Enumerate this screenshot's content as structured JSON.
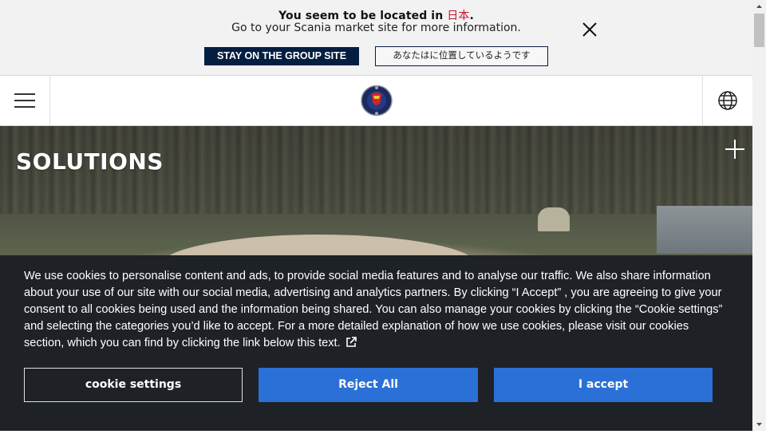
{
  "location_banner": {
    "line1_prefix": "You seem to be located in ",
    "country": "日本",
    "line1_suffix": ".",
    "line2": "Go to your Scania market site for more information.",
    "stay_button": "STAY ON THE GROUP SITE",
    "local_button": "あなたはに位置しているようです"
  },
  "header": {
    "menu_icon": "hamburger-menu-icon",
    "logo_icon": "scania-griffin-logo",
    "globe_icon": "globe-icon"
  },
  "hero": {
    "title": "SOLUTIONS",
    "expand_icon": "plus-icon"
  },
  "cookie_banner": {
    "text": "We use cookies to personalise content and ads, to provide social media features and to analyse our traffic. We also share information about your use of our site with our social media, advertising and analytics partners. By clicking “I Accept” , you are agreeing to give your consent to all cookies being used and the information being shared. You can also manage your cookies by clicking the “Cookie settings” and selecting the categories you’d like to accept. For a more detailed explanation of how we use cookies, please visit our cookies section, which you can find by clicking the link below this text.",
    "link_icon": "external-link-icon",
    "settings_button": "cookie settings",
    "reject_button": "Reject All",
    "accept_button": "I accept"
  },
  "colors": {
    "navy": "#041e42",
    "accent_blue": "#2b70d6",
    "banner_bg": "#1e2226",
    "country_red": "#c8102e"
  }
}
